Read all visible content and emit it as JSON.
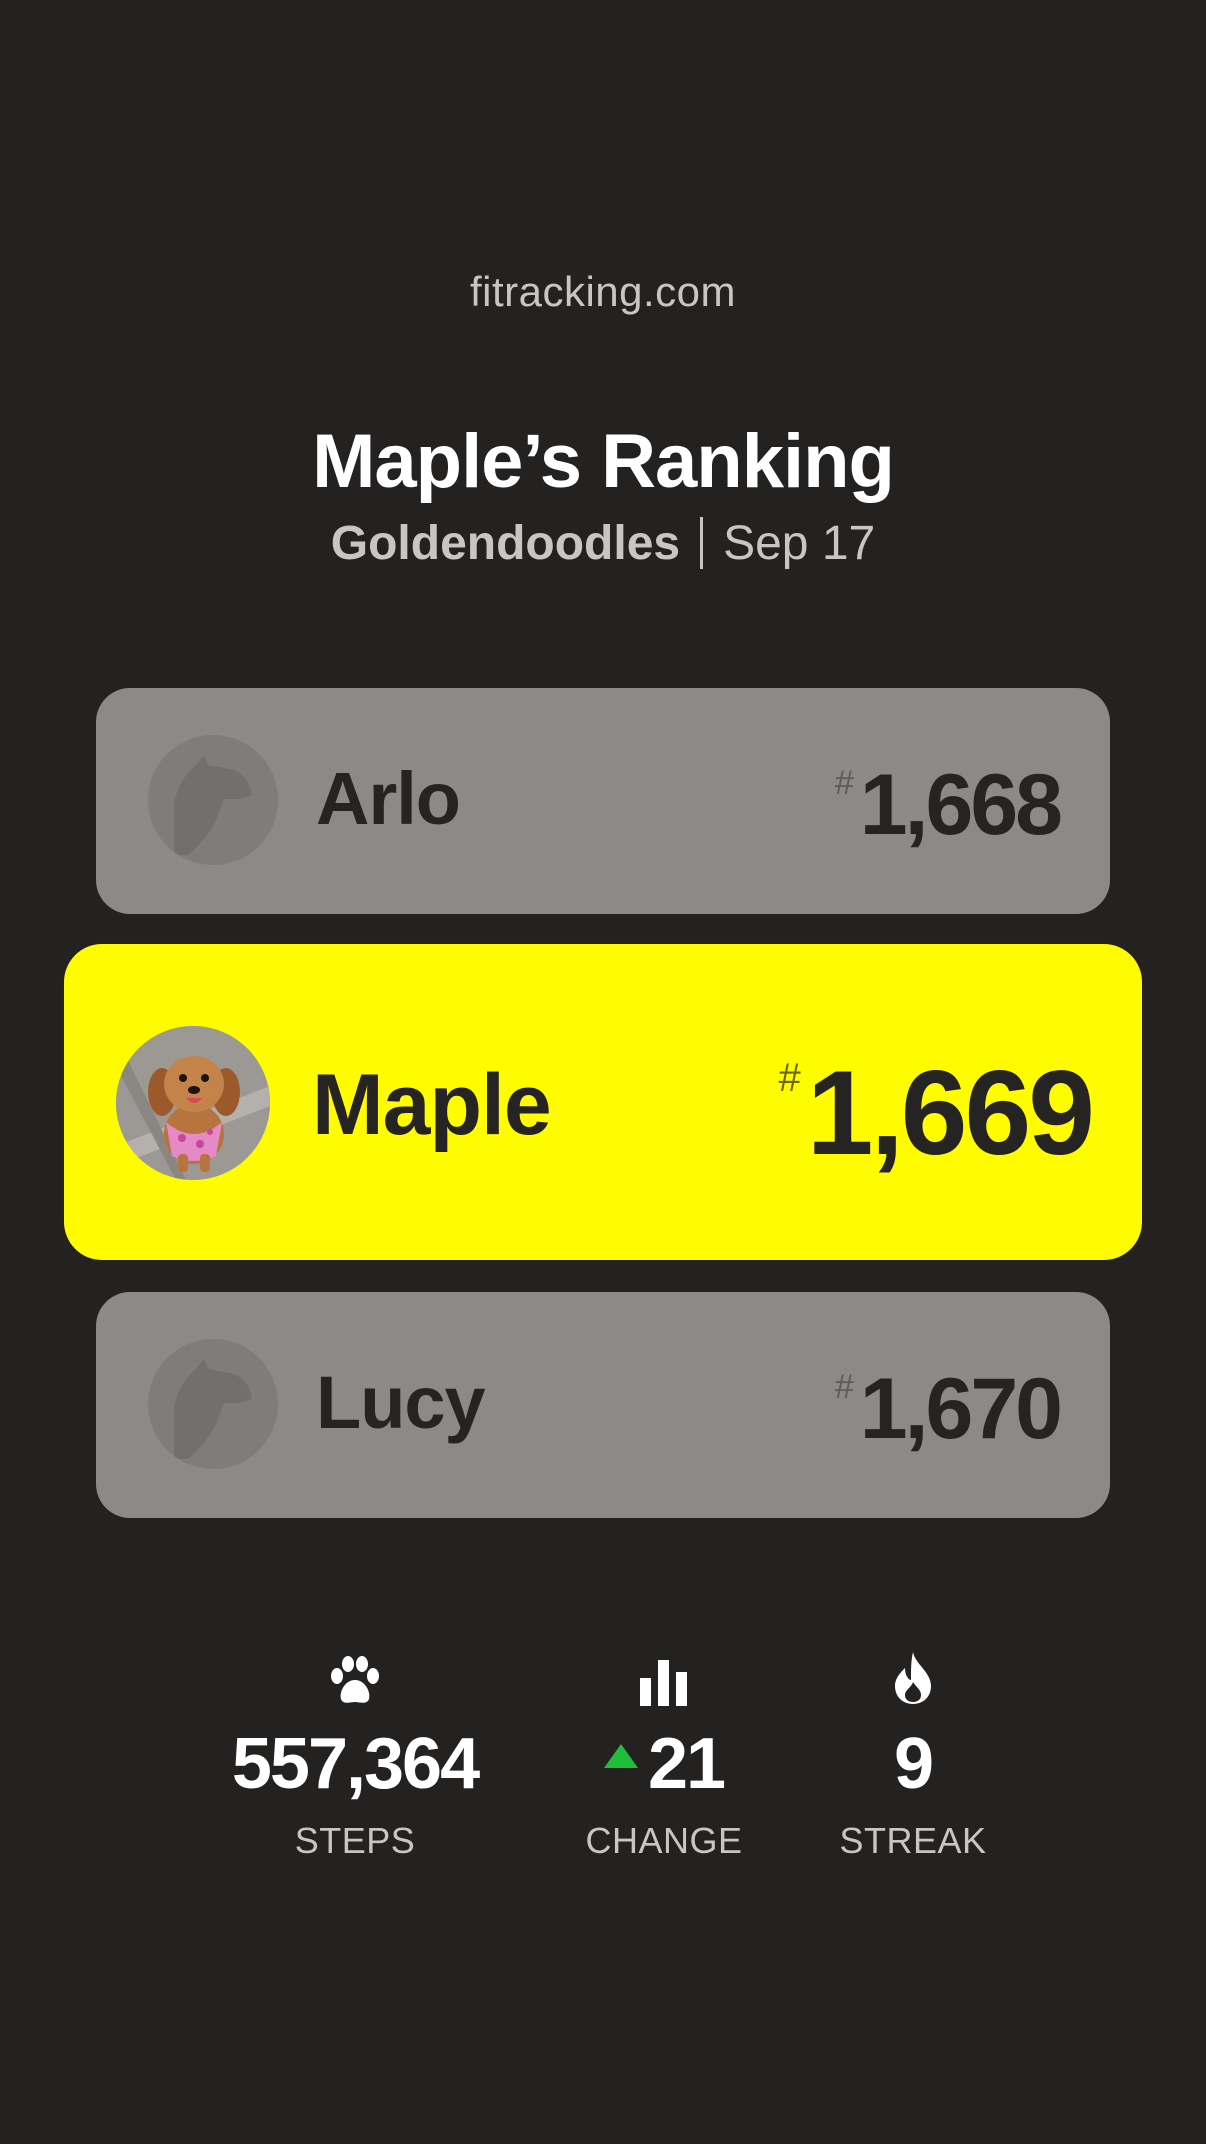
{
  "site": "fitracking.com",
  "title": "Maple’s Ranking",
  "subtitle": {
    "breed": "Goldendoodles",
    "date": "Sep 17"
  },
  "colors": {
    "background": "#242121",
    "highlight": "#fffb00",
    "neighbor_card": "#8b8a88",
    "up": "#1fbf3a"
  },
  "rankings": {
    "above": {
      "name": "Arlo",
      "hash": "#",
      "rank": "1,668",
      "avatar": "dog-silhouette-icon"
    },
    "current": {
      "name": "Maple",
      "hash": "#",
      "rank": "1,669",
      "avatar": "dog-photo"
    },
    "below": {
      "name": "Lucy",
      "hash": "#",
      "rank": "1,670",
      "avatar": "dog-silhouette-icon"
    }
  },
  "stats": {
    "steps": {
      "icon": "paw-icon",
      "value": "557,364",
      "label": "STEPS"
    },
    "change": {
      "icon": "bar-chart-icon",
      "direction": "up",
      "value": "21",
      "label": "CHANGE"
    },
    "streak": {
      "icon": "flame-icon",
      "value": "9",
      "label": "STREAK"
    }
  }
}
